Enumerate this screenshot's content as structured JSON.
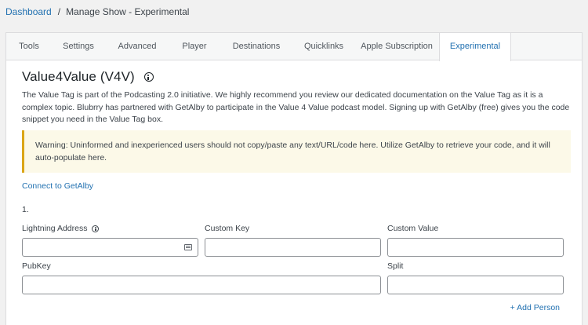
{
  "breadcrumb": {
    "root": "Dashboard",
    "separator": "/",
    "current": "Manage Show - Experimental"
  },
  "tabs": [
    {
      "label": "Tools",
      "active": false
    },
    {
      "label": "Settings",
      "active": false
    },
    {
      "label": "Advanced",
      "active": false
    },
    {
      "label": "Player",
      "active": false
    },
    {
      "label": "Destinations",
      "active": false
    },
    {
      "label": "Quicklinks",
      "active": false
    },
    {
      "label": "Apple Subscription",
      "active": false
    },
    {
      "label": "Experimental",
      "active": true
    }
  ],
  "section": {
    "title": "Value4Value (V4V)",
    "description": "The Value Tag is part of the Podcasting 2.0 initiative. We highly recommend you review our dedicated documentation on the Value Tag as it is a complex topic. Blubrry has partnered with GetAlby to participate in the Value 4 Value podcast model. Signing up with GetAlby (free) gives you the code snippet you need in the Value Tag box.",
    "warning": "Warning: Uninformed and inexperienced users should not copy/paste any text/URL/code here. Utilize GetAlby to retrieve your code, and it will auto-populate here.",
    "connect_link": "Connect to GetAlby",
    "person_number": "1."
  },
  "form": {
    "lightning_address": {
      "label": "Lightning Address",
      "value": ""
    },
    "custom_key": {
      "label": "Custom Key",
      "value": ""
    },
    "custom_value": {
      "label": "Custom Value",
      "value": ""
    },
    "pubkey": {
      "label": "PubKey",
      "value": ""
    },
    "split": {
      "label": "Split",
      "value": ""
    },
    "add_person": "+ Add Person"
  },
  "colors": {
    "link": "#2271b1",
    "warning_border": "#dba617",
    "warning_bg": "#fcf9e8"
  }
}
